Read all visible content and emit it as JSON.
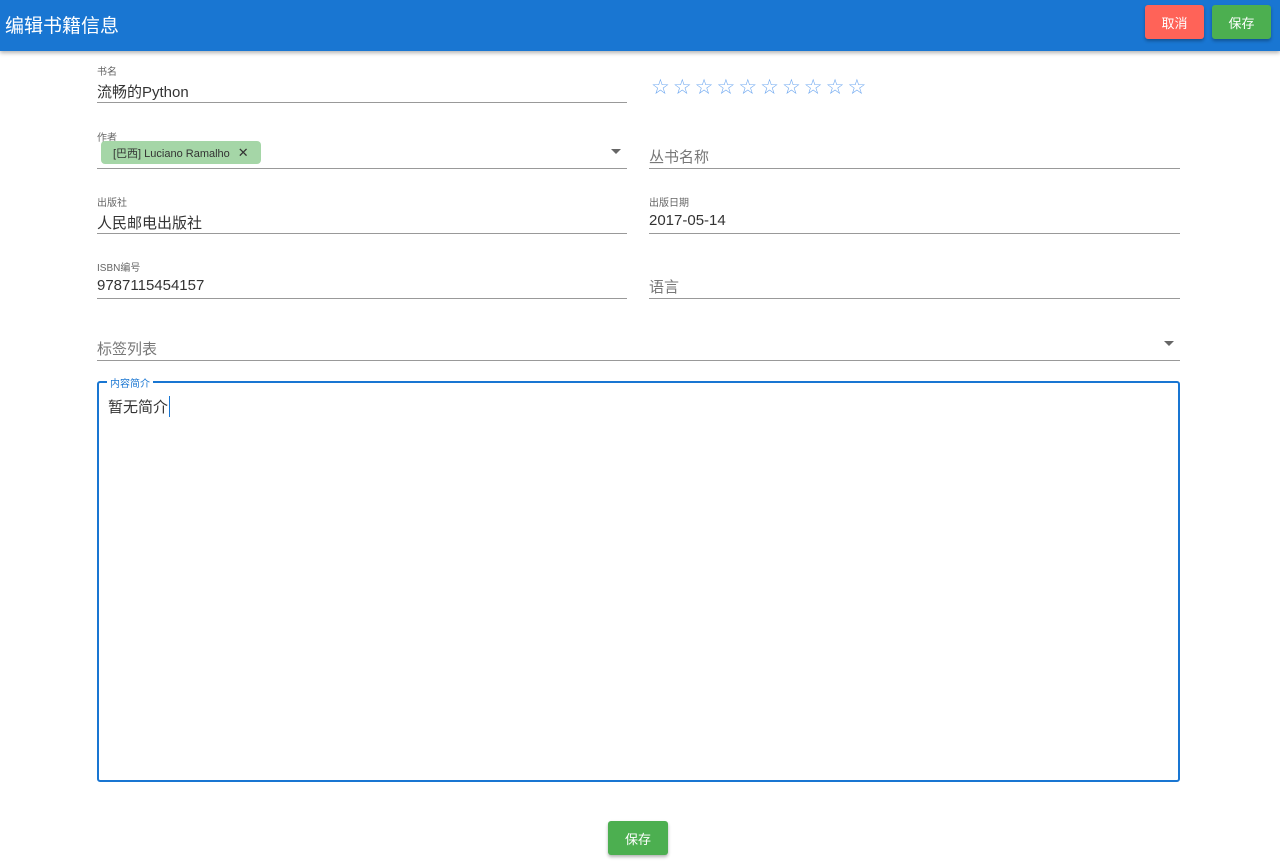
{
  "header": {
    "title": "编辑书籍信息",
    "cancel": "取消",
    "save": "保存"
  },
  "colors": {
    "header": "#1976d2",
    "cancel": "#ff6358",
    "save": "#4caf50",
    "star": "#6fa8f0",
    "chip": "#a5d6a7"
  },
  "form": {
    "title": {
      "label": "书名",
      "value": "流畅的Python"
    },
    "rating": {
      "value": 0,
      "max": 10,
      "icon": "star-outline-icon"
    },
    "author": {
      "label": "作者",
      "chip": "[巴西] Luciano Ramalho"
    },
    "series": {
      "placeholder": "丛书名称"
    },
    "publisher": {
      "label": "出版社",
      "value": "人民邮电出版社"
    },
    "pubdate": {
      "label": "出版日期",
      "value": "2017-05-14"
    },
    "isbn": {
      "label": "ISBN编号",
      "value": "9787115454157"
    },
    "language": {
      "placeholder": "语言"
    },
    "tags": {
      "placeholder": "标签列表"
    },
    "summary": {
      "label": "内容简介",
      "value": "暂无简介"
    }
  },
  "footer": {
    "save": "保存"
  }
}
